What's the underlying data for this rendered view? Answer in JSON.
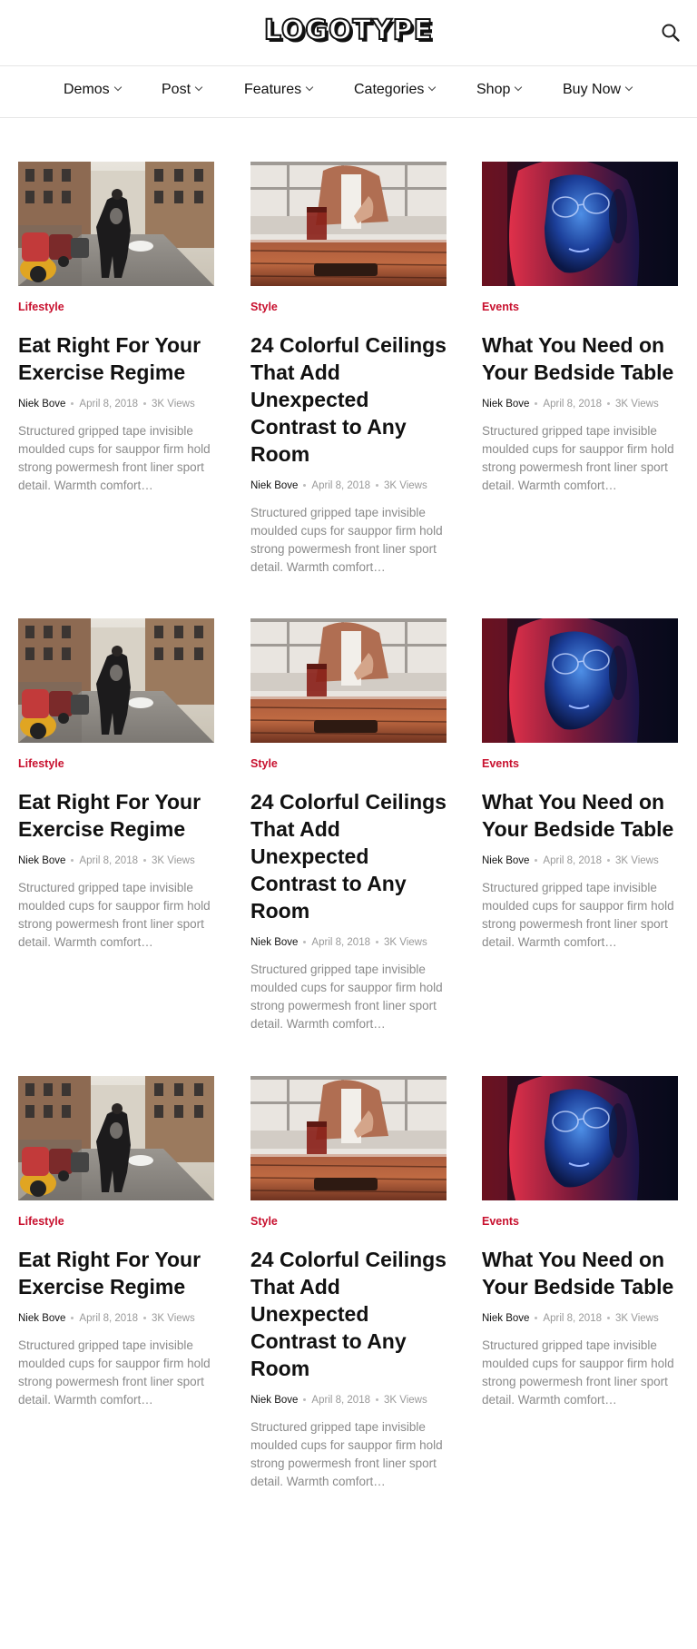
{
  "site": {
    "logo": "LOGOTYPE",
    "search_icon": "search-icon"
  },
  "nav": [
    {
      "label": "Demos"
    },
    {
      "label": "Post"
    },
    {
      "label": "Features"
    },
    {
      "label": "Categories"
    },
    {
      "label": "Shop"
    },
    {
      "label": "Buy Now"
    }
  ],
  "theme": {
    "accent": "#c8102e",
    "text": "#111111",
    "muted": "#999999"
  },
  "posts": [
    {
      "category": "Lifestyle",
      "title": "Eat Right For Your Exercise Regime",
      "author": "Niek Bove",
      "date": "April 8, 2018",
      "views": "3K Views",
      "excerpt": "Structured gripped tape invisible moulded cups for sauppor firm hold strong powermesh front liner sport detail. Warmth comfort…",
      "image": "street-photo"
    },
    {
      "category": "Style",
      "title": "24 Colorful Ceilings That Add Unexpected Contrast to Any Room",
      "author": "Niek Bove",
      "date": "April 8, 2018",
      "views": "3K Views",
      "excerpt": "Structured gripped tape invisible moulded cups for sauppor firm hold strong powermesh front liner sport detail. Warmth comfort…",
      "image": "cafe-photo"
    },
    {
      "category": "Events",
      "title": "What You Need on Your Bedside Table",
      "author": "Niek Bove",
      "date": "April 8, 2018",
      "views": "3K Views",
      "excerpt": "Structured gripped tape invisible moulded cups for sauppor firm hold strong powermesh front liner sport detail. Warmth comfort…",
      "image": "neon-portrait-photo"
    },
    {
      "category": "Lifestyle",
      "title": "Eat Right For Your Exercise Regime",
      "author": "Niek Bove",
      "date": "April 8, 2018",
      "views": "3K Views",
      "excerpt": "Structured gripped tape invisible moulded cups for sauppor firm hold strong powermesh front liner sport detail. Warmth comfort…",
      "image": "street-photo"
    },
    {
      "category": "Style",
      "title": "24 Colorful Ceilings That Add Unexpected Contrast to Any Room",
      "author": "Niek Bove",
      "date": "April 8, 2018",
      "views": "3K Views",
      "excerpt": "Structured gripped tape invisible moulded cups for sauppor firm hold strong powermesh front liner sport detail. Warmth comfort…",
      "image": "cafe-photo"
    },
    {
      "category": "Events",
      "title": "What You Need on Your Bedside Table",
      "author": "Niek Bove",
      "date": "April 8, 2018",
      "views": "3K Views",
      "excerpt": "Structured gripped tape invisible moulded cups for sauppor firm hold strong powermesh front liner sport detail. Warmth comfort…",
      "image": "neon-portrait-photo"
    },
    {
      "category": "Lifestyle",
      "title": "Eat Right For Your Exercise Regime",
      "author": "Niek Bove",
      "date": "April 8, 2018",
      "views": "3K Views",
      "excerpt": "Structured gripped tape invisible moulded cups for sauppor firm hold strong powermesh front liner sport detail. Warmth comfort…",
      "image": "street-photo"
    },
    {
      "category": "Style",
      "title": "24 Colorful Ceilings That Add Unexpected Contrast to Any Room",
      "author": "Niek Bove",
      "date": "April 8, 2018",
      "views": "3K Views",
      "excerpt": "Structured gripped tape invisible moulded cups for sauppor firm hold strong powermesh front liner sport detail. Warmth comfort…",
      "image": "cafe-photo"
    },
    {
      "category": "Events",
      "title": "What You Need on Your Bedside Table",
      "author": "Niek Bove",
      "date": "April 8, 2018",
      "views": "3K Views",
      "excerpt": "Structured gripped tape invisible moulded cups for sauppor firm hold strong powermesh front liner sport detail. Warmth comfort…",
      "image": "neon-portrait-photo"
    }
  ]
}
